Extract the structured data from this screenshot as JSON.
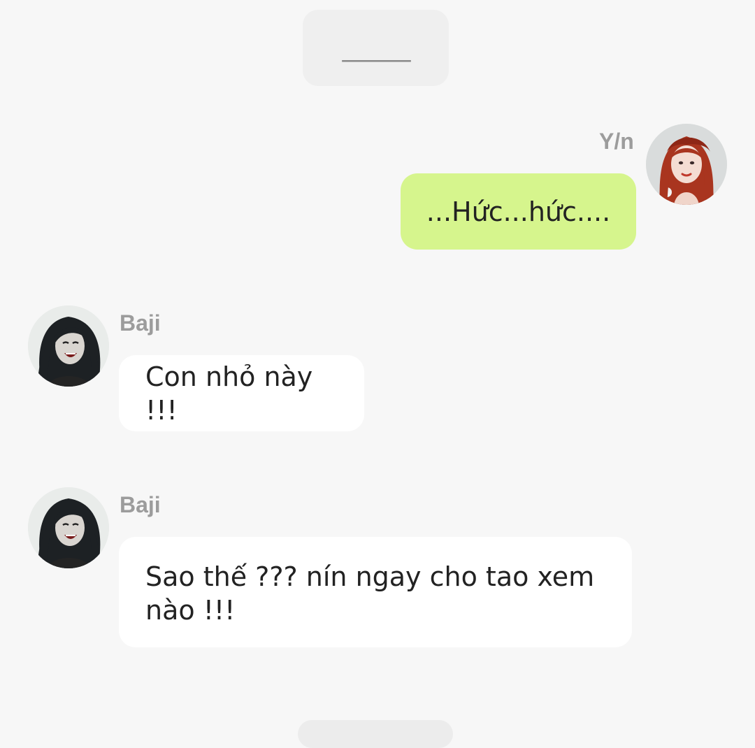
{
  "divider": {
    "text": "______"
  },
  "messages": [
    {
      "sender": "Y/n",
      "side": "right",
      "text": "...Hức...hức....",
      "avatar_icon": "red-haired-girl-avatar-icon"
    },
    {
      "sender": "Baji",
      "side": "left",
      "text": "Con nhỏ này !!!",
      "avatar_icon": "long-black-hair-boy-avatar-icon"
    },
    {
      "sender": "Baji",
      "side": "left",
      "text": "Sao thế ??? nín ngay cho tao xem nào !!!",
      "avatar_icon": "long-black-hair-boy-avatar-icon"
    }
  ],
  "colors": {
    "background": "#f7f7f7",
    "my_bubble": "#d6f58d",
    "other_bubble": "#ffffff",
    "name_text": "#9c9c9c",
    "message_text": "#222222"
  }
}
